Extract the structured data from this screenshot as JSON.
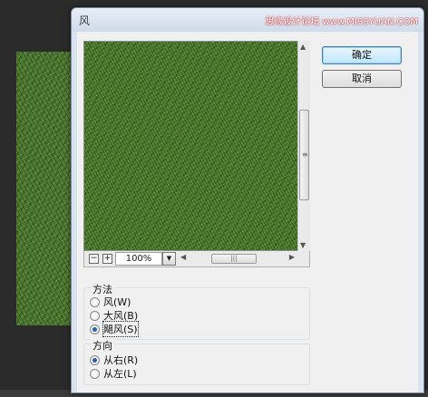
{
  "dialog": {
    "title": "风",
    "watermark": "思缘设计论坛 www.MISSYUAN.COM"
  },
  "preview": {
    "zoom_value": "100%",
    "zoom_out_symbol": "−",
    "zoom_in_symbol": "+"
  },
  "buttons": {
    "ok": "确定",
    "cancel": "取消"
  },
  "method": {
    "label": "方法",
    "options": [
      {
        "label": "风(W)",
        "selected": false
      },
      {
        "label": "大风(B)",
        "selected": false
      },
      {
        "label": "飓风(S)",
        "selected": true
      }
    ]
  },
  "direction": {
    "label": "方向",
    "options": [
      {
        "label": "从右(R)",
        "selected": true
      },
      {
        "label": "从左(L)",
        "selected": false
      }
    ]
  },
  "icons": {
    "scroll_up": "▲",
    "scroll_down": "▼",
    "scroll_left": "◀",
    "scroll_right": "▶",
    "dropdown": "▼",
    "grip_v": "≡",
    "grip_h": "|||"
  },
  "colors": {
    "grass": "#4d7b30",
    "dialog_bg": "#f0f0f0",
    "default_button": "#bee6fd"
  }
}
